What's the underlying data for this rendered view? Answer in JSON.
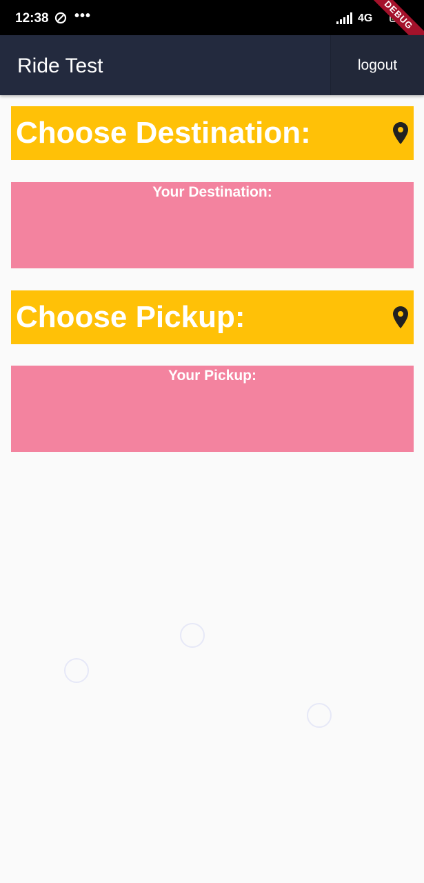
{
  "status_bar": {
    "time": "12:38",
    "dots": "•••",
    "network": "4G",
    "debug_banner": "DEBUG"
  },
  "app_bar": {
    "title": "Ride Test",
    "logout_label": "logout"
  },
  "destination": {
    "title": "Choose Destination:",
    "display_label": "Your Destination:"
  },
  "pickup": {
    "title": "Choose Pickup:",
    "display_label": "Your Pickup:"
  },
  "colors": {
    "app_bar": "#232A3E",
    "choose_bar": "#FFC107",
    "display_box": "#F3839F",
    "background": "#FAFAFA"
  },
  "icons": {
    "location": "location-pin-icon",
    "signal": "cell-signal-icon",
    "battery": "battery-icon",
    "status": "data-saver-icon"
  }
}
